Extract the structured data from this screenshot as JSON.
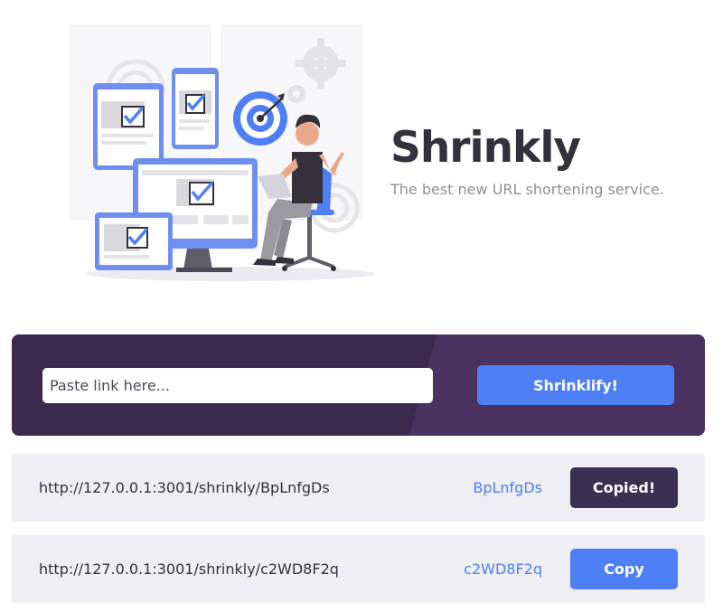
{
  "brand": {
    "title": "Shrinkly",
    "tagline": "The best new URL shortening service."
  },
  "form": {
    "input_placeholder": "Paste link here...",
    "input_value": "",
    "submit_label": "Shrinklify!"
  },
  "results": [
    {
      "full_url": "http://127.0.0.1:3001/shrinkly/BpLnfgDs",
      "short_code": "BpLnfgDs",
      "copy_label": "Copied!",
      "state": "copied"
    },
    {
      "full_url": "http://127.0.0.1:3001/shrinkly/c2WD8F2q",
      "short_code": "c2WD8F2q",
      "copy_label": "Copy",
      "state": "idle"
    }
  ],
  "colors": {
    "accent": "#4f7ff5",
    "panel_dark": "#3b2a4d",
    "panel_light": "#4a3260",
    "copied_button": "#3a3052",
    "row_background": "#eeeef3",
    "title_text": "#34313d"
  },
  "illustration": {
    "subject": "person-at-desk-with-devices-illustration"
  }
}
